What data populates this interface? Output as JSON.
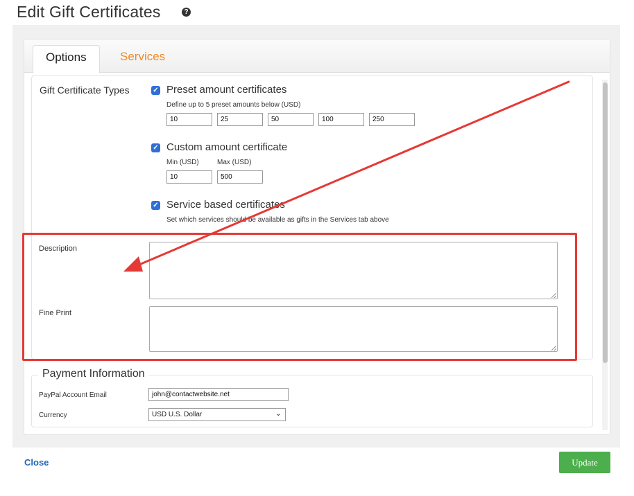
{
  "header": {
    "title": "Edit Gift Certificates",
    "help_glyph": "?"
  },
  "tabs": [
    {
      "label": "Options",
      "active": true
    },
    {
      "label": "Services",
      "active": false,
      "color": "#f08a24"
    }
  ],
  "gift_types": {
    "label": "Gift Certificate Types",
    "preset": {
      "checked": true,
      "label": "Preset amount certificates",
      "hint": "Define up to 5 preset amounts below (USD)",
      "amounts": [
        "10",
        "25",
        "50",
        "100",
        "250"
      ]
    },
    "custom": {
      "checked": true,
      "label": "Custom amount certificate",
      "min_label": "Min (USD)",
      "max_label": "Max (USD)",
      "min_value": "10",
      "max_value": "500"
    },
    "service": {
      "checked": true,
      "label": "Service based certificates",
      "hint": "Set which services should be available as gifts in the Services tab above"
    }
  },
  "description": {
    "label": "Description",
    "value": ""
  },
  "fine_print": {
    "label": "Fine Print",
    "value": ""
  },
  "payment": {
    "legend": "Payment Information",
    "paypal_label": "PayPal Account Email",
    "paypal_value": "john@contactwebsite.net",
    "currency_label": "Currency",
    "currency_value": "USD U.S. Dollar"
  },
  "footer": {
    "close_label": "Close",
    "update_label": "Update"
  },
  "colors": {
    "annotation": "#e53935",
    "checkbox": "#2f6fd6",
    "update_button": "#4cae4c",
    "link": "#1f66b3"
  }
}
